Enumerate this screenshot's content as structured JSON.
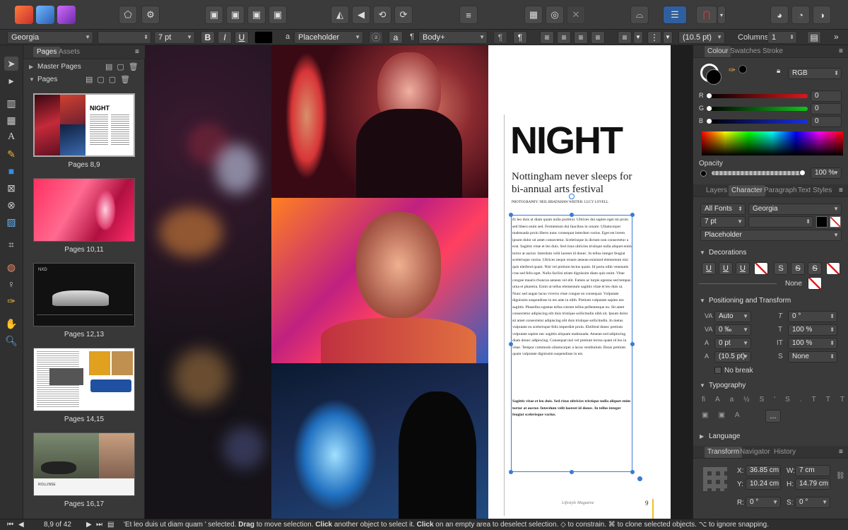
{
  "context_bar": {
    "font_family": "Georgia",
    "font_style": "",
    "font_size": "7 pt",
    "bold": "B",
    "italic": "I",
    "underline": "U",
    "char_style": "Placeholder",
    "para_style": "Body+",
    "leading": "(10.5 pt)",
    "columns_label": "Columns:",
    "columns_value": "1"
  },
  "pages_panel": {
    "tabs": [
      "Pages",
      "Assets"
    ],
    "master_pages": "Master Pages",
    "pages_section": "Pages",
    "thumbs": [
      {
        "label": "Pages 8,9"
      },
      {
        "label": "Pages 10,11"
      },
      {
        "label": "Pages 12,13"
      },
      {
        "label": "Pages 14,15"
      },
      {
        "label": "Pages 16,17"
      }
    ]
  },
  "document": {
    "headline": "NIGHT",
    "subhead_line1": "Nottingham never sleeps for",
    "subhead_line2": "bi-annual arts festival",
    "credits": "PHOTOGRAPHY: NEIL BRADSHAW  WRITER: LUCY LOVELL",
    "body": "Et leo duis ut diam quam nulla porttitor. Ultrices dui sapien eget mi proin sed libero enim sed. Fermentum dui faucibus in ornare. Ullamcorper malesuada proin libero nunc consequat interdum varius. Eget est lorem ipsum dolor sit amet consectetur. Scelerisque in dictum non consectetur a erat. Sagittis vitae et leo duis. Sed risus ultricies tristique nulla aliquet enim tortor at auctor. Interdum velit laoreet id donec. In tellus integer feugiat scelerisque varius. Ultrices neque ornare aenean euismod elementum nisi quis eleifend quam. Nisl vel pretium lectus quam. Id porta nibh venenatis cras sed felis eget. Nulla facilisi etiam dignissim diam quis enim. Vitae congue mauris rhoncus aenean vel elit. Fames ac turpis egestas sed tempus urna et pharetra. Enim ut tellus elementum sagittis vitae et leo duis ut. Nunc sed augue lacus viverra vitae congue eu consequat. Vulputate dignissim suspendisse in est ante in nibh. Pretium vulputate sapien nec sagittis. Phasellus egestas tellus rutrum tellus pellentesque eu. Sit amet consectetur adipiscing elit duis tristique sollicitudin nibh sit. Ipsum dolor sit amet consectetur adipiscing elit duis tristique sollicitudin. In metus vulputate eu scelerisque felis imperdiet proin. Eleifend donec pretium vulputate sapien nec sagittis aliquam malesuada. Aenean sed adipiscing diam donec adipiscing. Consequat nisl vel pretium lectus quam id leo in vitae. Tempor commodo ullamcorper a lacus vestibulum. Risus pretium quam vulputate dignissim suspendisse in est.",
    "bold_para": "Sagittis vitae et leo duis. Sed risus ultricies tristique nulla aliquet enim tortor at auctor. Interdum velit laoreet id donec. In tellus integer feugiat scelerisque varius.",
    "footer_mag": "Lifestyle Magazine",
    "footer_page": "9"
  },
  "right_panel": {
    "top_tabs": [
      "Colour",
      "Swatches",
      "Stroke"
    ],
    "color_model": "RGB",
    "r_label": "R",
    "r_value": "0",
    "g_label": "G",
    "g_value": "0",
    "b_label": "B",
    "b_value": "0",
    "opacity_label": "Opacity",
    "opacity_value": "100 %",
    "mid_tabs": [
      "Layers",
      "Character",
      "Paragraph",
      "Text Styles"
    ],
    "font_collection": "All Fonts",
    "font_family": "Georgia",
    "font_size": "7 pt",
    "style": "Placeholder",
    "decorations": "Decorations",
    "none_label": "None",
    "pos_transform": "Positioning and Transform",
    "kerning": "Auto",
    "tracking": "0 ‰",
    "baseline": "0 pt",
    "leading": "(10.5 pt)",
    "shear": "0 °",
    "scale_h": "100 %",
    "scale_v": "100 %",
    "snap": "None",
    "no_break": "No break",
    "typography": "Typography",
    "language": "Language",
    "bottom_tabs": [
      "Transform",
      "Navigator",
      "History"
    ],
    "x_label": "X:",
    "x_value": "36.85 cm",
    "y_label": "Y:",
    "y_value": "10.24 cm",
    "w_label": "W:",
    "w_value": "7 cm",
    "h_label": "H:",
    "h_value": "14.79 cm",
    "r2_label": "R:",
    "r2_value": "0 °",
    "s_label": "S:",
    "s_value": "0 °"
  },
  "status_bar": {
    "page_indicator": "8,9 of 42",
    "message_pre": "'Et leo duis ut diam quam ' selected. ",
    "drag": "Drag",
    "m1": " to move selection. ",
    "click": "Click",
    "m2": " another object to select it. ",
    "click2": "Click",
    "m3": " on an empty area to deselect selection. ◇ to constrain. ⌘ to clone selected objects. ⌥ to ignore snapping."
  },
  "colors": {
    "accent": "#2f6fd1",
    "selection": "#3a7bd5",
    "hue_red": "#e0161a",
    "hue_green": "#13c21b",
    "hue_blue": "#1a2fe0"
  }
}
